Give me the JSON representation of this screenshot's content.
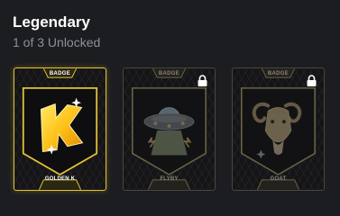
{
  "section": {
    "title": "Legendary",
    "subtitle": "1 of 3 Unlocked"
  },
  "badges": [
    {
      "header": "BADGE",
      "name": "GOLDEN K",
      "icon": "golden-k-icon",
      "locked": false
    },
    {
      "header": "BADGE",
      "name": "FLYBY",
      "icon": "ufo-icon",
      "locked": true
    },
    {
      "header": "BADGE",
      "name": "GOAT",
      "icon": "goat-icon",
      "locked": true
    }
  ],
  "colors": {
    "background": "#1c1d21",
    "gold": "#e7c332",
    "locked_border": "#4a4638",
    "subtitle": "#8e9099"
  }
}
